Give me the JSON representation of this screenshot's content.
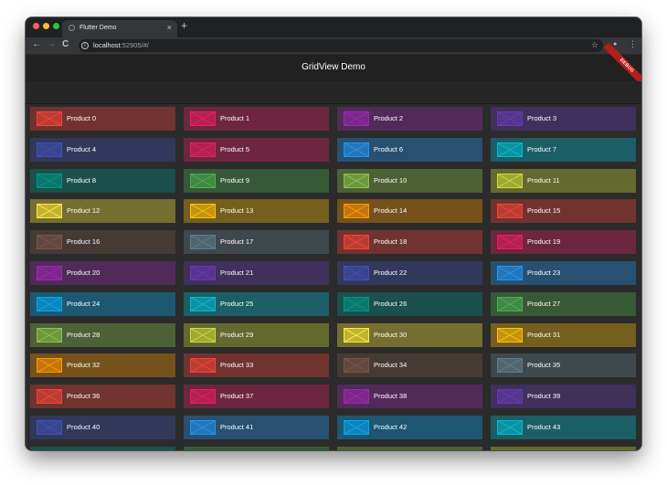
{
  "browser": {
    "tab_title": "Flutter Demo",
    "tab_close": "×",
    "new_tab": "+",
    "back": "←",
    "forward": "→",
    "reload": "C",
    "url_host": "localhost",
    "url_rest": ":52905/#/",
    "info_glyph": "i",
    "bookmark": "☆",
    "profile": "●",
    "menu": "⋮",
    "traffic_lights": [
      "#ff5f57",
      "#febc2e",
      "#28c840"
    ]
  },
  "app": {
    "title": "GridView Demo",
    "debug_banner": "DEBUG",
    "products": [
      {
        "label": "Product 0",
        "color": "#f44336"
      },
      {
        "label": "Product 1",
        "color": "#e91e63"
      },
      {
        "label": "Product 2",
        "color": "#9c27b0"
      },
      {
        "label": "Product 3",
        "color": "#673ab7"
      },
      {
        "label": "Product 4",
        "color": "#3f51b5"
      },
      {
        "label": "Product 5",
        "color": "#e91e63"
      },
      {
        "label": "Product 6",
        "color": "#2196f3"
      },
      {
        "label": "Product 7",
        "color": "#00bcd4"
      },
      {
        "label": "Product 8",
        "color": "#009688"
      },
      {
        "label": "Product 9",
        "color": "#4caf50"
      },
      {
        "label": "Product 10",
        "color": "#8bc34a"
      },
      {
        "label": "Product 11",
        "color": "#cddc39"
      },
      {
        "label": "Product 12",
        "color": "#ffeb3b"
      },
      {
        "label": "Product 13",
        "color": "#ffc107"
      },
      {
        "label": "Product 14",
        "color": "#ff9800"
      },
      {
        "label": "Product 15",
        "color": "#f44336"
      },
      {
        "label": "Product 16",
        "color": "#795548"
      },
      {
        "label": "Product 17",
        "color": "#607d8b"
      },
      {
        "label": "Product 18",
        "color": "#f44336"
      },
      {
        "label": "Product 19",
        "color": "#e91e63"
      },
      {
        "label": "Product 20",
        "color": "#9c27b0"
      },
      {
        "label": "Product 21",
        "color": "#673ab7"
      },
      {
        "label": "Product 22",
        "color": "#3f51b5"
      },
      {
        "label": "Product 23",
        "color": "#2196f3"
      },
      {
        "label": "Product 24",
        "color": "#03a9f4"
      },
      {
        "label": "Product 25",
        "color": "#00bcd4"
      },
      {
        "label": "Product 26",
        "color": "#009688"
      },
      {
        "label": "Product 27",
        "color": "#4caf50"
      },
      {
        "label": "Product 28",
        "color": "#8bc34a"
      },
      {
        "label": "Product 29",
        "color": "#cddc39"
      },
      {
        "label": "Product 30",
        "color": "#ffeb3b"
      },
      {
        "label": "Product 31",
        "color": "#ffc107"
      },
      {
        "label": "Product 32",
        "color": "#ff9800"
      },
      {
        "label": "Product 33",
        "color": "#f44336"
      },
      {
        "label": "Product 34",
        "color": "#795548"
      },
      {
        "label": "Product 35",
        "color": "#607d8b"
      },
      {
        "label": "Product 36",
        "color": "#f44336"
      },
      {
        "label": "Product 37",
        "color": "#e91e63"
      },
      {
        "label": "Product 38",
        "color": "#9c27b0"
      },
      {
        "label": "Product 39",
        "color": "#673ab7"
      },
      {
        "label": "Product 40",
        "color": "#3f51b5"
      },
      {
        "label": "Product 41",
        "color": "#2196f3"
      },
      {
        "label": "Product 42",
        "color": "#03a9f4"
      },
      {
        "label": "Product 43",
        "color": "#00bcd4"
      },
      {
        "label": "",
        "color": "#009688"
      },
      {
        "label": "",
        "color": "#4caf50"
      },
      {
        "label": "",
        "color": "#8bc34a"
      },
      {
        "label": "",
        "color": "#cddc39"
      }
    ]
  }
}
